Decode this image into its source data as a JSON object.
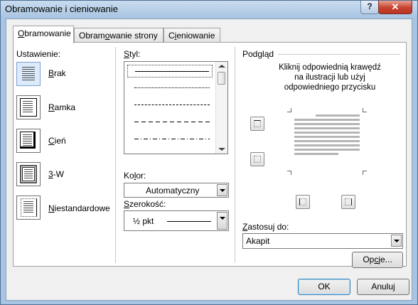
{
  "window": {
    "title": "Obramowanie i cieniowanie",
    "help_label": "?",
    "close_label": "✕"
  },
  "tabs": [
    {
      "pre": "",
      "ul": "O",
      "post": "bramowanie"
    },
    {
      "pre": "Obram",
      "ul": "o",
      "post": "wanie strony"
    },
    {
      "pre": "C",
      "ul": "i",
      "post": "eniowanie"
    }
  ],
  "setting": {
    "heading": "Ustawienie:",
    "items": [
      {
        "pre": "",
        "ul": "B",
        "post": "rak",
        "icon": "no-border-icon"
      },
      {
        "pre": "",
        "ul": "R",
        "post": "amka",
        "icon": "box-border-icon"
      },
      {
        "pre": "",
        "ul": "C",
        "post": "ień",
        "icon": "shadow-border-icon"
      },
      {
        "pre": "",
        "ul": "3",
        "post": "-W",
        "icon": "3d-border-icon"
      },
      {
        "pre": "",
        "ul": "N",
        "post": "iestandardowe",
        "icon": "custom-border-icon"
      }
    ]
  },
  "style": {
    "pre": "",
    "ul": "S",
    "post": "tyl:"
  },
  "color": {
    "pre": "Ko",
    "ul": "l",
    "post": "or:",
    "value": "Automatyczny"
  },
  "width": {
    "pre": "",
    "ul": "S",
    "post": "zerokość:",
    "value": "½ pkt"
  },
  "preview": {
    "heading": "Podgląd",
    "line1": "Kliknij odpowiednią krawędź",
    "line2": "na ilustracji lub użyj",
    "line3": "odpowiedniego przycisku"
  },
  "apply": {
    "pre": "",
    "ul": "Z",
    "post": "astosuj do:",
    "value": "Akapit"
  },
  "buttons": {
    "options": {
      "pre": "Op",
      "ul": "c",
      "post": "je..."
    },
    "ok": "OK",
    "cancel": "Anuluj"
  }
}
